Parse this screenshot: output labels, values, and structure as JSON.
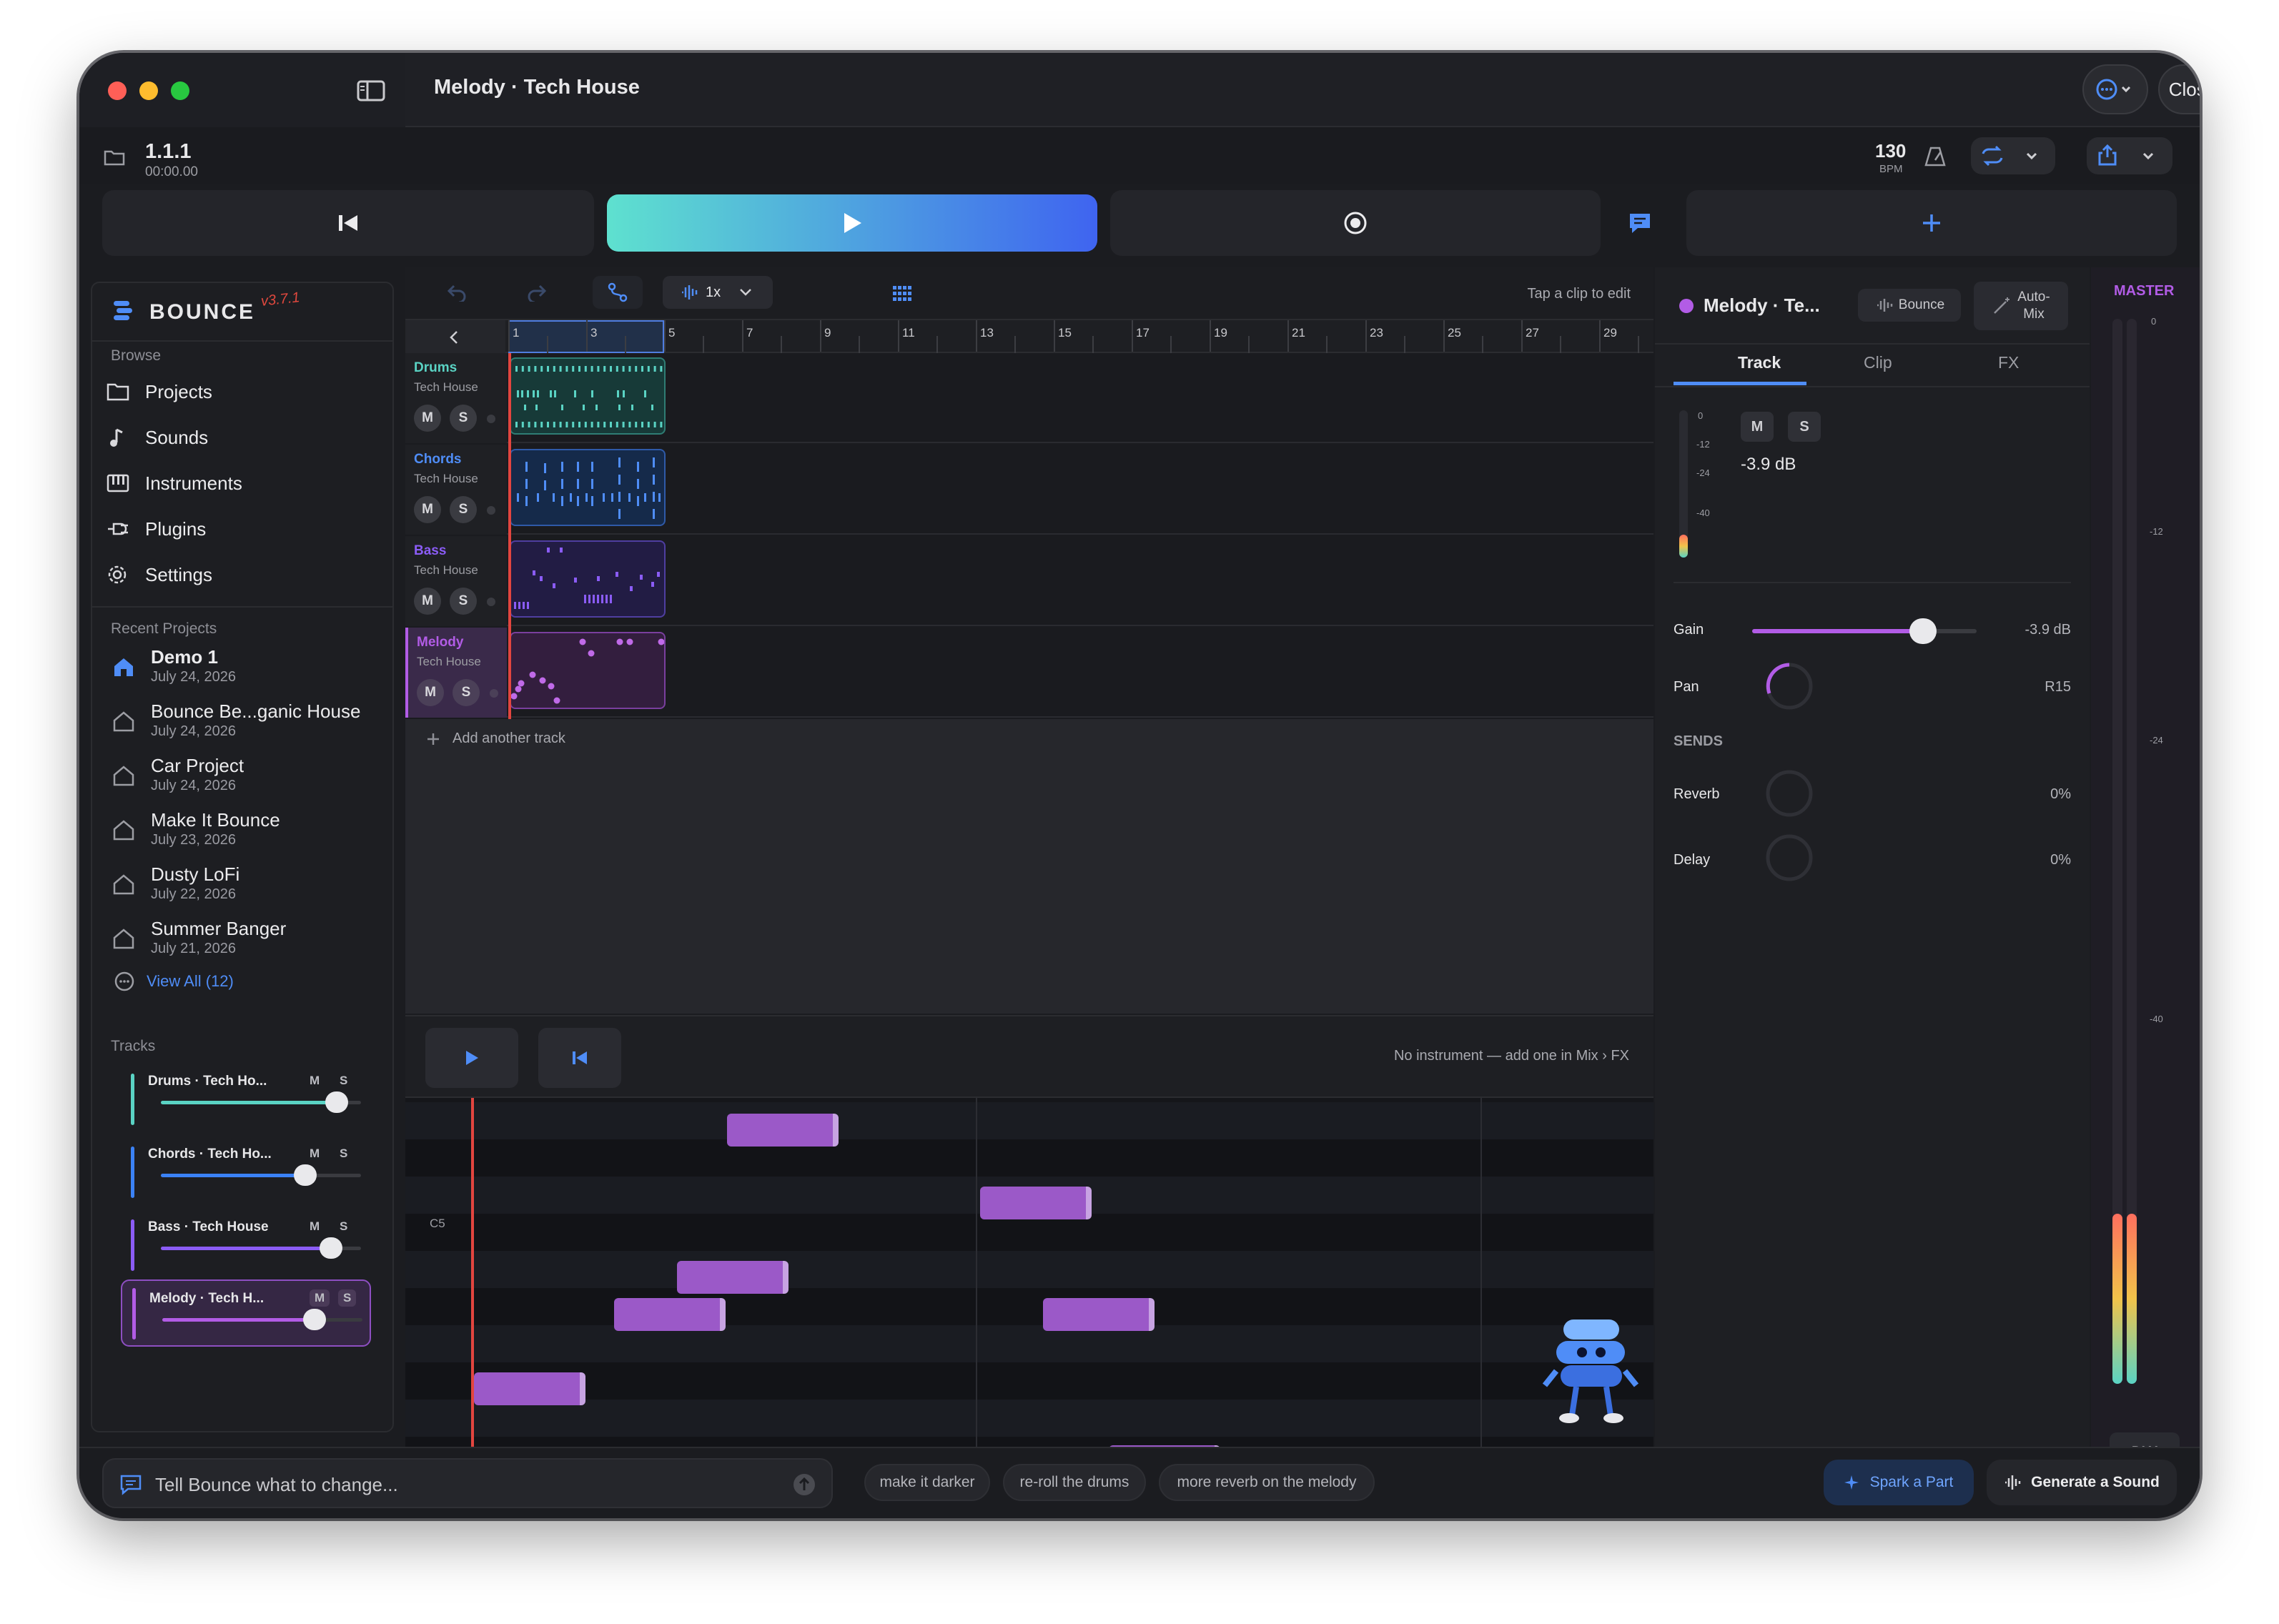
{
  "window": {
    "title": "Melody · Tech House",
    "close_label": "Close"
  },
  "transport": {
    "position": "1.1.1",
    "time": "00:00.00",
    "tempo": "130",
    "tempo_unit": "BPM"
  },
  "app": {
    "name": "BOUNCE",
    "version": "v3.7.1"
  },
  "sidebar": {
    "browse_header": "Browse",
    "items": [
      {
        "label": "Projects"
      },
      {
        "label": "Sounds"
      },
      {
        "label": "Instruments"
      },
      {
        "label": "Plugins"
      },
      {
        "label": "Settings"
      }
    ],
    "recent_header": "Recent Projects",
    "recent": [
      {
        "name": "Demo 1",
        "date": "July 24, 2026"
      },
      {
        "name": "Bounce Be...ganic House",
        "date": "July 24, 2026"
      },
      {
        "name": "Car Project",
        "date": "July 24, 2026"
      },
      {
        "name": "Make It Bounce",
        "date": "July 23, 2026"
      },
      {
        "name": "Dusty LoFi",
        "date": "July 22, 2026"
      },
      {
        "name": "Summer Banger",
        "date": "July 21, 2026"
      }
    ],
    "view_all": "View All (12)",
    "tracks_header": "Tracks",
    "tracks": [
      {
        "name": "Drums · Tech Ho...",
        "m": "M",
        "s": "S",
        "level": 0.88,
        "color": "#5ad3c4"
      },
      {
        "name": "Chords · Tech Ho...",
        "m": "M",
        "s": "S",
        "level": 0.72,
        "color": "#3b82f6"
      },
      {
        "name": "Bass · Tech House",
        "m": "M",
        "s": "S",
        "level": 0.85,
        "color": "#8b5cf6"
      },
      {
        "name": "Melody · Tech H...",
        "m": "M",
        "s": "S",
        "level": 0.76,
        "color": "#b25ce6"
      }
    ]
  },
  "editor": {
    "zoom": "1x",
    "hint": "Tap a clip to edit",
    "add_track": "Add another track",
    "ruler": [
      "1",
      "3",
      "5",
      "7",
      "9",
      "11",
      "13",
      "15",
      "17",
      "19",
      "21",
      "23",
      "25",
      "27",
      "29"
    ]
  },
  "lanes": [
    {
      "name": "Drums",
      "genre": "Tech House",
      "m": "M",
      "s": "S",
      "color": "#5ad3c4"
    },
    {
      "name": "Chords",
      "genre": "Tech House",
      "m": "M",
      "s": "S",
      "color": "#4f8df7"
    },
    {
      "name": "Bass",
      "genre": "Tech House",
      "m": "M",
      "s": "S",
      "color": "#8b5cf6"
    },
    {
      "name": "Melody",
      "genre": "Tech House",
      "m": "M",
      "s": "S",
      "color": "#b25ce6"
    }
  ],
  "piano_roll": {
    "message": "No instrument — add one in Mix › FX",
    "note_label": "C5"
  },
  "inspector": {
    "title": "Melody · Te...",
    "bounce": "Bounce",
    "automix": "Auto-\nMix",
    "tabs": [
      "Track",
      "Clip",
      "FX"
    ],
    "meter_scale": [
      "0",
      "-12",
      "-24",
      "-40"
    ],
    "m": "M",
    "s": "S",
    "db": "-3.9 dB",
    "gain_label": "Gain",
    "gain_value": "-3.9 dB",
    "gain_level": 0.76,
    "pan_label": "Pan",
    "pan_value": "R15",
    "sends_header": "SENDS",
    "reverb_label": "Reverb",
    "reverb_value": "0%",
    "delay_label": "Delay",
    "delay_value": "0%"
  },
  "master": {
    "label": "MASTER",
    "scale": [
      "0",
      "-12",
      "-24",
      "-40"
    ],
    "button": "DLY",
    "level": 0.16
  },
  "prompt": {
    "placeholder": "Tell Bounce what to change...",
    "suggestions": [
      "make it darker",
      "re-roll the drums",
      "more reverb on the melody"
    ],
    "spark": "Spark a Part",
    "generate": "Generate a Sound"
  },
  "colors": {
    "accent": "#3b82f6",
    "melody": "#b25ce6",
    "drums": "#5ad3c4",
    "bass": "#8b5cf6"
  }
}
